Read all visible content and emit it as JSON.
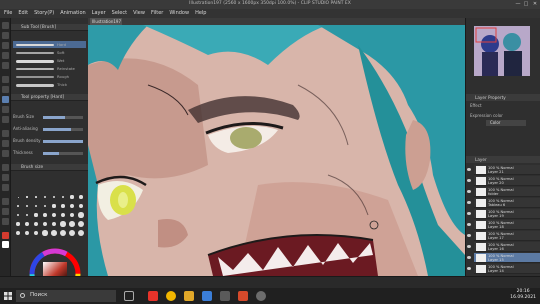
{
  "window": {
    "title": "Illustration197 (2560 x 1600px 350dpi 100.0%) - CLIP STUDIO PAINT EX",
    "controls": [
      "—",
      "□",
      "✕"
    ]
  },
  "menu": [
    "File",
    "Edit",
    "Story(P)",
    "Animation",
    "Layer",
    "Select",
    "View",
    "Filter",
    "Window",
    "Help"
  ],
  "left_panel": {
    "tool_header": "Sub Tool [Brush]",
    "brushes": [
      {
        "name": "Hard"
      },
      {
        "name": "Soft"
      },
      {
        "name": "Wet"
      },
      {
        "name": "Reinstate"
      },
      {
        "name": "Rough"
      },
      {
        "name": "Thick"
      }
    ],
    "property_header": "Tool property [Hard]",
    "properties": [
      {
        "label": "Brush Size",
        "value": 0.55
      },
      {
        "label": "Anti-aliasing",
        "value": 0.7
      },
      {
        "label": "Brush density",
        "value": 1.0
      },
      {
        "label": "Thickness",
        "value": 0.4
      }
    ],
    "size_header": "Brush size"
  },
  "canvas": {
    "tab_label": "Illustration197"
  },
  "right_panel": {
    "navigator_header": "Navigator",
    "layer_property_header": "Layer Property",
    "effect_label": "Effect",
    "expression_label": "Expression color",
    "expression_value": "Color",
    "layer_header": "Layer",
    "layers": [
      {
        "name": "100 % Normal\nLayer 21"
      },
      {
        "name": "100 % Normal\nLayer 20"
      },
      {
        "name": "100 % Normal\nfolder"
      },
      {
        "name": "100 % Normal\nTableau 6"
      },
      {
        "name": "100 % Normal\nLayer 19"
      },
      {
        "name": "100 % Normal\nLayer 18"
      },
      {
        "name": "100 % Normal\nLayer 17"
      },
      {
        "name": "100 % Normal\nLayer 16"
      },
      {
        "name": "100 % Normal\nLayer 15"
      },
      {
        "name": "100 % Normal\nLayer 14"
      }
    ],
    "selected_layer_index": 8
  },
  "taskbar": {
    "search_placeholder": "Поиск",
    "time": "20:16",
    "date": "16.09.2021",
    "icons": [
      "task-view-icon",
      "yandex-icon",
      "chrome-icon",
      "explorer-icon",
      "mail-icon",
      "store-icon",
      "office-icon",
      "clip-studio-icon"
    ]
  },
  "colors": {
    "accent": "#5c7aa3",
    "skin": "#d9b8ad",
    "hair": "#2e9ba8",
    "eye": "#d9e04a"
  }
}
